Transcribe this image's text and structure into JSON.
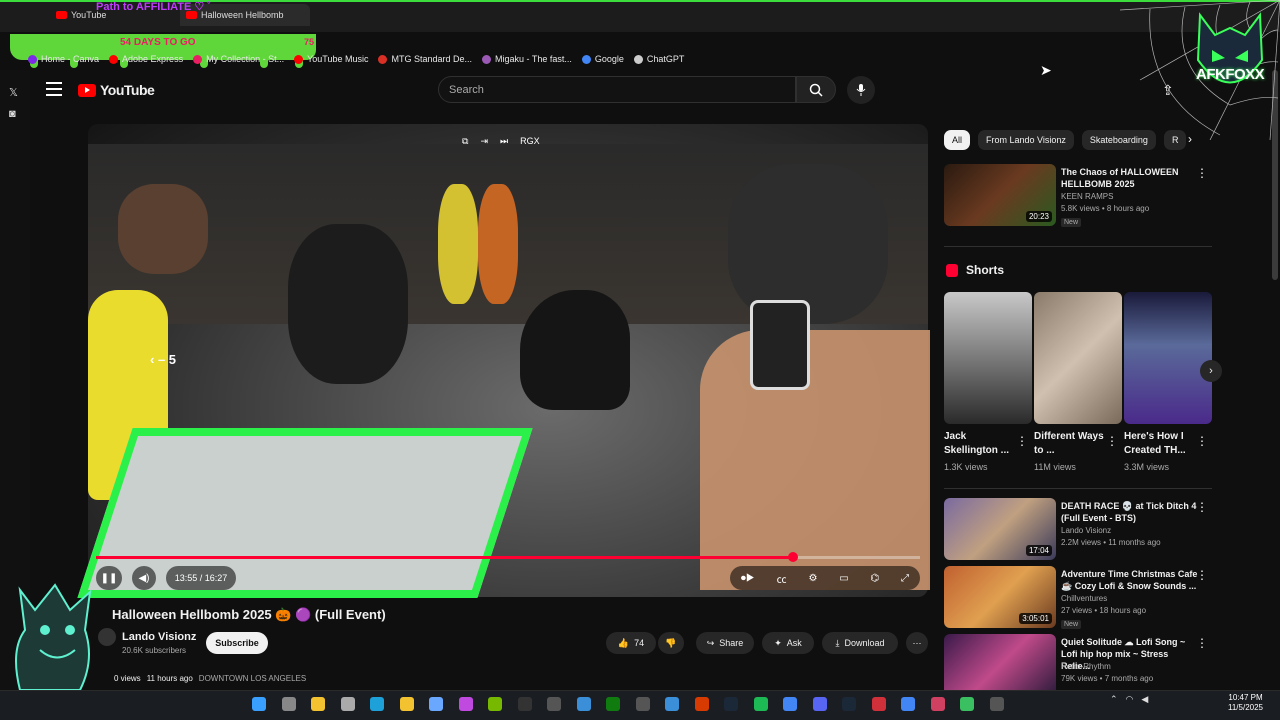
{
  "browser": {
    "tabs": [
      {
        "label": "YouTube"
      },
      {
        "label": "Halloween Hellbomb"
      }
    ],
    "overlay_affiliate": "Path to AFFILIATE ♡ ˚",
    "days_to_go": "54 DAYS TO GO",
    "slime_value": "75",
    "bookmarks": [
      {
        "label": "Home - Canva",
        "icon": "canva-icon",
        "color": "#7d2ae8"
      },
      {
        "label": "Adobe Express",
        "icon": "adobe-icon",
        "color": "#ff0000"
      },
      {
        "label": "My Collection - St...",
        "icon": "collection-icon",
        "color": "#e91e63"
      },
      {
        "label": "YouTube Music",
        "icon": "youtube-music-icon",
        "color": "#ff0000"
      },
      {
        "label": "MTG Standard De...",
        "icon": "mtg-icon",
        "color": "#d93025"
      },
      {
        "label": "Migaku - The fast...",
        "icon": "migaku-icon",
        "color": "#9b59b6"
      },
      {
        "label": "Google",
        "icon": "google-icon",
        "color": "#4285f4"
      },
      {
        "label": "ChatGPT",
        "icon": "chatgpt-icon",
        "color": "#cccccc"
      }
    ]
  },
  "youtube": {
    "logo_text": "YouTube",
    "search_placeholder": "Search",
    "video": {
      "skip_label": "5",
      "overlay_icons": [
        "miniplayer-icon",
        "theater-icon",
        "next-icon",
        "RGX"
      ],
      "current_time": "13:55",
      "duration": "16:27",
      "time_display": "13:55 / 16:27",
      "progress": 0.846,
      "title": "Halloween Hellbomb 2025 🎃 🟣 (Full Event)",
      "channel": "Lando Visionz",
      "subscribers": "20.6K subscribers",
      "subscribe_label": "Subscribe",
      "likes": "74",
      "share_label": "Share",
      "ask_label": "Ask",
      "download_label": "Download",
      "views": "0 views",
      "posted": "11 hours ago",
      "location": "DOWNTOWN LOS ANGELES"
    },
    "chips": [
      "All",
      "From Lando Visionz",
      "Skateboarding",
      "R"
    ],
    "recommendations": [
      {
        "title": "The Chaos of HALLOWEEN HELLBOMB 2025",
        "channel": "KEEN RAMPS",
        "stats": "5.8K views • 8 hours ago",
        "badge": "New",
        "duration": "20:23",
        "thumb_color": "#4a2a20"
      },
      {
        "title": "DEATH RACE 💀 at Tick Ditch 4 (Full Event - BTS)",
        "channel": "Lando Visionz",
        "stats": "2.2M views • 11 months ago",
        "badge": "",
        "duration": "17:04",
        "thumb_color": "#6a5a8a"
      },
      {
        "title": "Adventure Time Christmas Cafe ☕ Cozy Lofi & Snow Sounds ...",
        "channel": "Chillventures",
        "stats": "27 views • 18 hours ago",
        "badge": "New",
        "duration": "3:05:01",
        "thumb_color": "#a4552a"
      },
      {
        "title": "Quiet Solitude ☁ Lofi Song ~ Lofi hip hop mix ~ Stress Relie...",
        "channel": "Retro-Rhythm",
        "stats": "79K views • 7 months ago",
        "badge": "",
        "duration": "",
        "thumb_color": "#5a2a60"
      }
    ],
    "shorts_title": "Shorts",
    "shorts": [
      {
        "title": "Jack Skellington ...",
        "views": "1.3K views",
        "thumb_color": "#8a8a8a"
      },
      {
        "title": "Different Ways to ...",
        "views": "11M views",
        "thumb_color": "#b8a898"
      },
      {
        "title": "Here's How I Created TH...",
        "views": "3.3M views",
        "thumb_color": "#3a4a7a"
      }
    ]
  },
  "overlay": {
    "brand": "AFKFOXX",
    "accent": "#3aff5a"
  },
  "taskbar": {
    "time": "10:47 PM",
    "date": "11/5/2025",
    "apps": [
      "windows-start-icon",
      "task-view-icon",
      "files-icon",
      "settings-icon",
      "edge-icon",
      "explorer-icon",
      "notepad-icon",
      "copilot-icon",
      "nvidia-icon",
      "davinci-icon",
      "terminal-icon",
      "photos-icon",
      "xbox-icon",
      "obs-icon",
      "app-icon",
      "office-icon",
      "steam-icon",
      "spotify-icon",
      "chrome-icon",
      "discord-icon",
      "steam2-icon",
      "app2-icon",
      "chrome2-icon",
      "obs2-icon",
      "app3-icon",
      "app4-icon"
    ]
  }
}
